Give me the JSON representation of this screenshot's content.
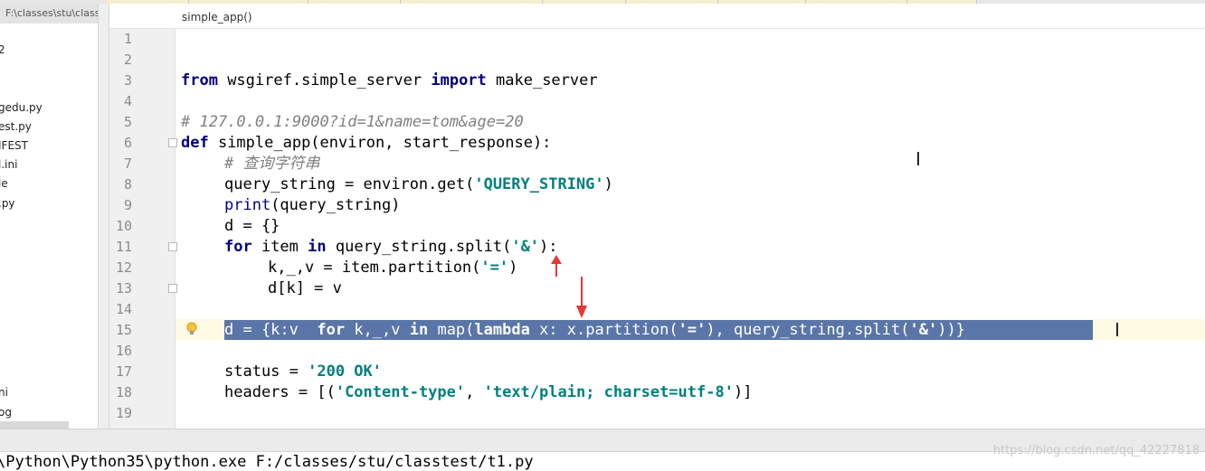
{
  "breadcrumb": "simple_app()",
  "project_path": "F:\\classes\\stu\\classt",
  "files": [
    "2",
    "gedu.py",
    "est.py",
    "IFEST",
    "l.ini",
    "le",
    ".py",
    "ni",
    "og"
  ],
  "line_numbers": [
    "1",
    "2",
    "3",
    "4",
    "5",
    "6",
    "7",
    "8",
    "9",
    "10",
    "11",
    "12",
    "13",
    "14",
    "15",
    "16",
    "17",
    "18",
    "19"
  ],
  "code": {
    "l3": [
      "from",
      " wsgiref.simple_server ",
      "import",
      " make_server"
    ],
    "l5": "# 127.0.0.1:9000?id=1&name=tom&age=20",
    "l6": [
      "def",
      " simple_app(environ, start_response):"
    ],
    "l7": "# 查询字符串",
    "l8": [
      "query_string = environ.get(",
      "'QUERY_STRING'",
      ")"
    ],
    "l9": [
      "print",
      "(query_string)"
    ],
    "l10": "d = {}",
    "l11": [
      "for",
      " item ",
      "in",
      " query_string.split(",
      "'&'",
      "):"
    ],
    "l12": [
      "k,_,v = item.partition(",
      "'='",
      ")"
    ],
    "l13": "d[k] = v",
    "l15": [
      "d = {k:v  ",
      "for",
      " k,_,v ",
      "in",
      " map(",
      "lambda",
      " x: x.partition(",
      "'='",
      "), query_string.split(",
      "'&'",
      "))}"
    ],
    "l17": [
      "status = ",
      "'200 OK'"
    ],
    "l18": [
      "headers = [(",
      "'Content-type'",
      ", ",
      "'text/plain; charset=utf-8'",
      ")]"
    ]
  },
  "console_command": "\\Python\\Python35\\python.exe F:/classes/stu/classtest/t1.py",
  "watermark": "https://blog.csdn.net/qq_42227818",
  "colors": {
    "keyword": "#000080",
    "string": "#008080",
    "comment": "#808080",
    "selection": "#5a75a7",
    "arrow": "#e53935"
  }
}
